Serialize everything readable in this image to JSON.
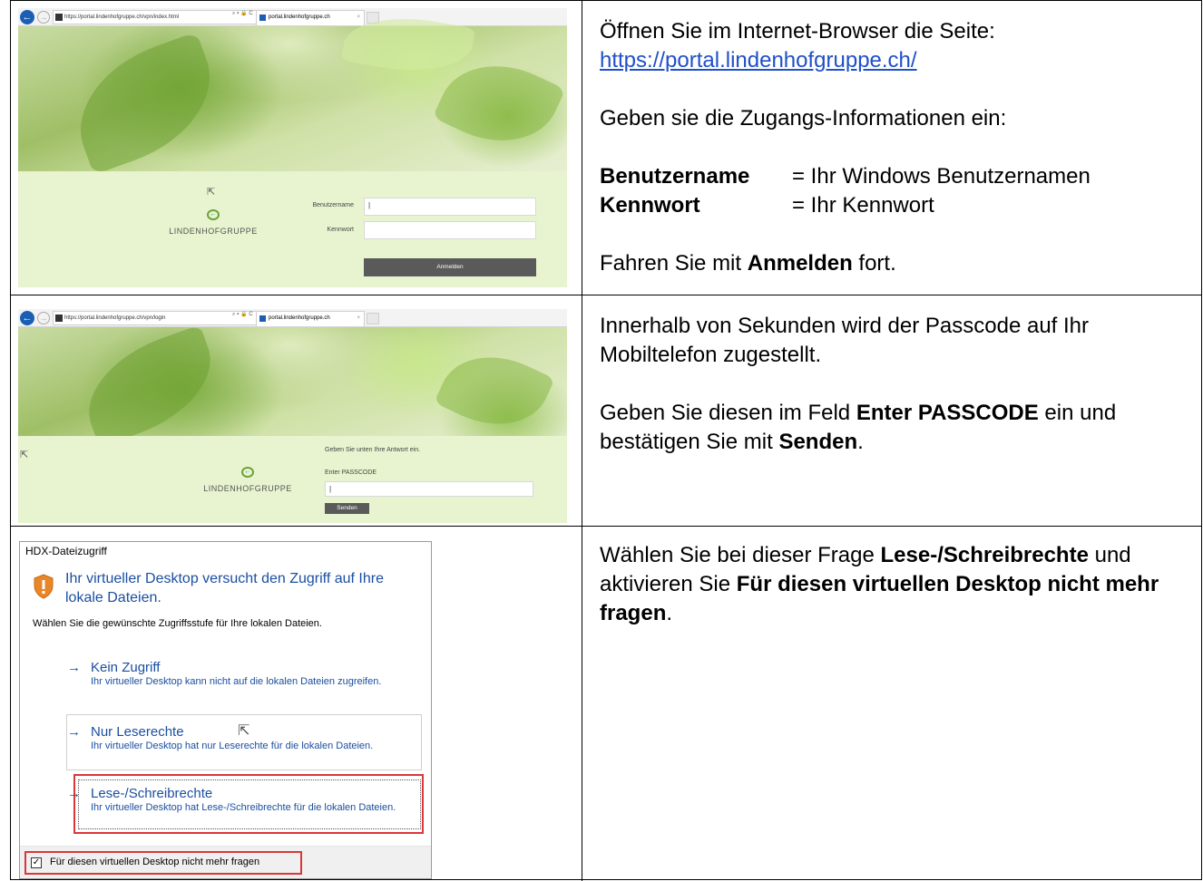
{
  "step1": {
    "browser": {
      "url": "https://portal.lindenhofgruppe.ch/vpn/index.html",
      "tab_title": "portal.lindenhofgruppe.ch",
      "tools": "⌕ ▾ 🔒 C"
    },
    "logo_text": "LINDENHOFGRUPPE",
    "username_label": "Benutzername",
    "password_label": "Kennwort",
    "username_value": "|",
    "submit_label": "Anmelden",
    "instructions": {
      "intro": "Öffnen Sie im Internet-Browser die Seite:",
      "link": "https://portal.lindenhofgruppe.ch/",
      "access_info": "Geben sie die Zugangs-Informationen ein:",
      "username_key": "Benutzername",
      "username_val": "= Ihr Windows Benutzernamen",
      "password_key": "Kennwort",
      "password_val": "= Ihr Kennwort",
      "continue_pre": "Fahren Sie mit ",
      "continue_bold": "Anmelden",
      "continue_post": " fort."
    }
  },
  "step2": {
    "browser": {
      "url": "https://portal.lindenhofgruppe.ch/vpn/login",
      "tab_title": "portal.lindenhofgruppe.ch",
      "tools": "⌕ ▾ 🔒 C"
    },
    "logo_text": "LINDENHOFGRUPPE",
    "prompt": "Geben Sie unten Ihre Antwort ein.",
    "passcode_label": "Enter PASSCODE",
    "passcode_value": "|",
    "submit_label": "Senden",
    "instructions": {
      "line1": "Innerhalb von Sekunden wird der Passcode auf Ihr Mobiltelefon zugestellt.",
      "line2_pre": "Geben Sie diesen im Feld ",
      "line2_bold": "Enter PASSCODE",
      "line2_mid": " ein und bestätigen Sie mit ",
      "line2_bold2": "Senden",
      "line2_post": "."
    }
  },
  "step3": {
    "dialog_title": "HDX-Dateizugriff",
    "heading": "Ihr virtueller Desktop versucht den Zugriff auf Ihre lokale Dateien.",
    "subtitle": "Wählen Sie die gewünschte Zugriffsstufe für Ihre lokalen Dateien.",
    "options": [
      {
        "title": "Kein Zugriff",
        "desc": "Ihr virtueller Desktop kann nicht auf die lokalen Dateien zugreifen."
      },
      {
        "title": "Nur Leserechte",
        "desc": "Ihr virtueller Desktop hat nur Leserechte für die lokalen Dateien."
      },
      {
        "title": "Lese-/Schreibrechte",
        "desc": "Ihr virtueller Desktop hat Lese-/Schreibrechte für die lokalen Dateien."
      }
    ],
    "checkbox_label": "Für diesen virtuellen Desktop nicht mehr fragen",
    "checkbox_checked": true,
    "instructions": {
      "pre": "Wählen Sie bei dieser Frage ",
      "bold1": "Lese-/Schreibrechte",
      "mid": " und aktivieren Sie ",
      "bold2": "Für diesen virtuellen Desktop nicht mehr fragen",
      "post": "."
    }
  },
  "colors": {
    "link": "#1f4fc9",
    "dialog_blue": "#1b4fa0",
    "highlight_red": "#d9373a",
    "login_bg": "#e8f4cf",
    "button_gray": "#5a5a5a"
  }
}
